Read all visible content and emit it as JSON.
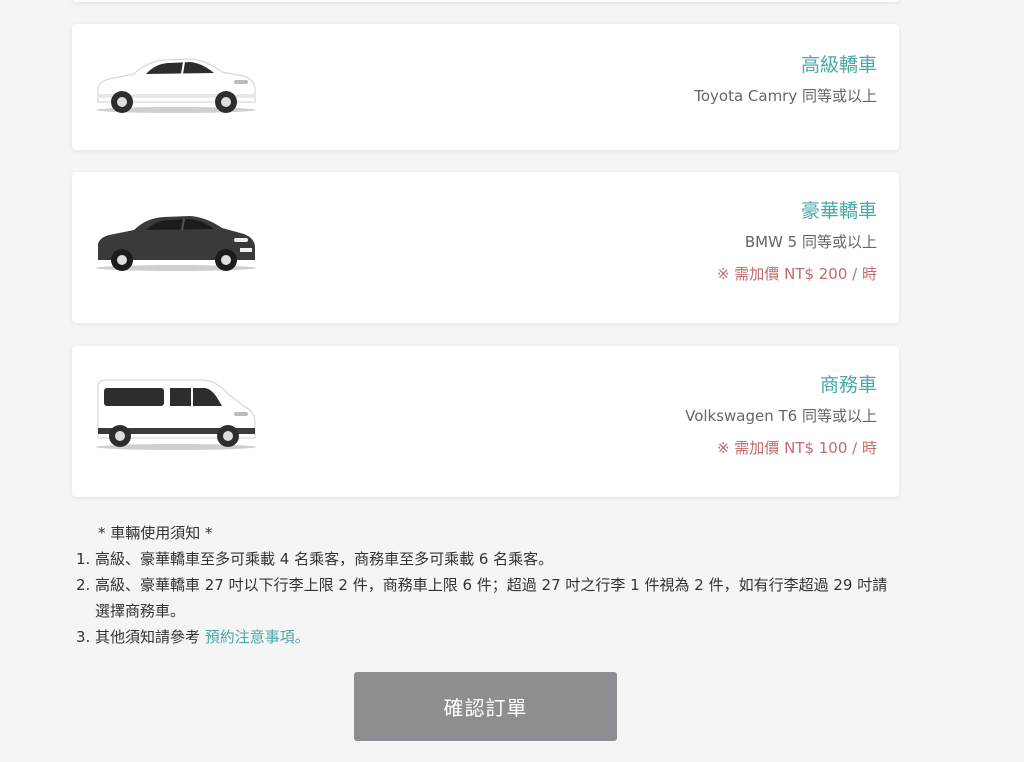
{
  "vehicles": [
    {
      "name": "高級轎車",
      "model": "Toyota Camry 同等或以上",
      "surcharge": null,
      "icon": "sedan-white-icon",
      "color": "#ffffff"
    },
    {
      "name": "豪華轎車",
      "model": "BMW 5 同等或以上",
      "surcharge": "※ 需加價 NT$ 200 / 時",
      "icon": "sedan-black-icon",
      "color": "#3a3a3a"
    },
    {
      "name": "商務車",
      "model": "Volkswagen T6 同等或以上",
      "surcharge": "※ 需加價 NT$ 100 / 時",
      "icon": "van-white-icon",
      "color": "#ffffff"
    }
  ],
  "notice": {
    "title": "* 車輛使用須知 *",
    "items": [
      {
        "num": "1.",
        "text": "高級、豪華轎車至多可乘載 4 名乘客，商務車至多可乘載 6 名乘客。"
      },
      {
        "num": "2.",
        "text": "高級、豪華轎車 27 吋以下行李上限 2 件，商務車上限 6 件；超過 27 吋之行李 1 件視為 2 件，如有行李超過 29 吋請選擇商務車。"
      },
      {
        "num": "3.",
        "text": "其他須知請參考 ",
        "link": "預約注意事項。"
      }
    ]
  },
  "confirm_button": "確認訂單",
  "colors": {
    "accent": "#4aa8a6",
    "surcharge": "#c46a6a",
    "button": "#8e8e92",
    "background": "#f5f5f5"
  }
}
